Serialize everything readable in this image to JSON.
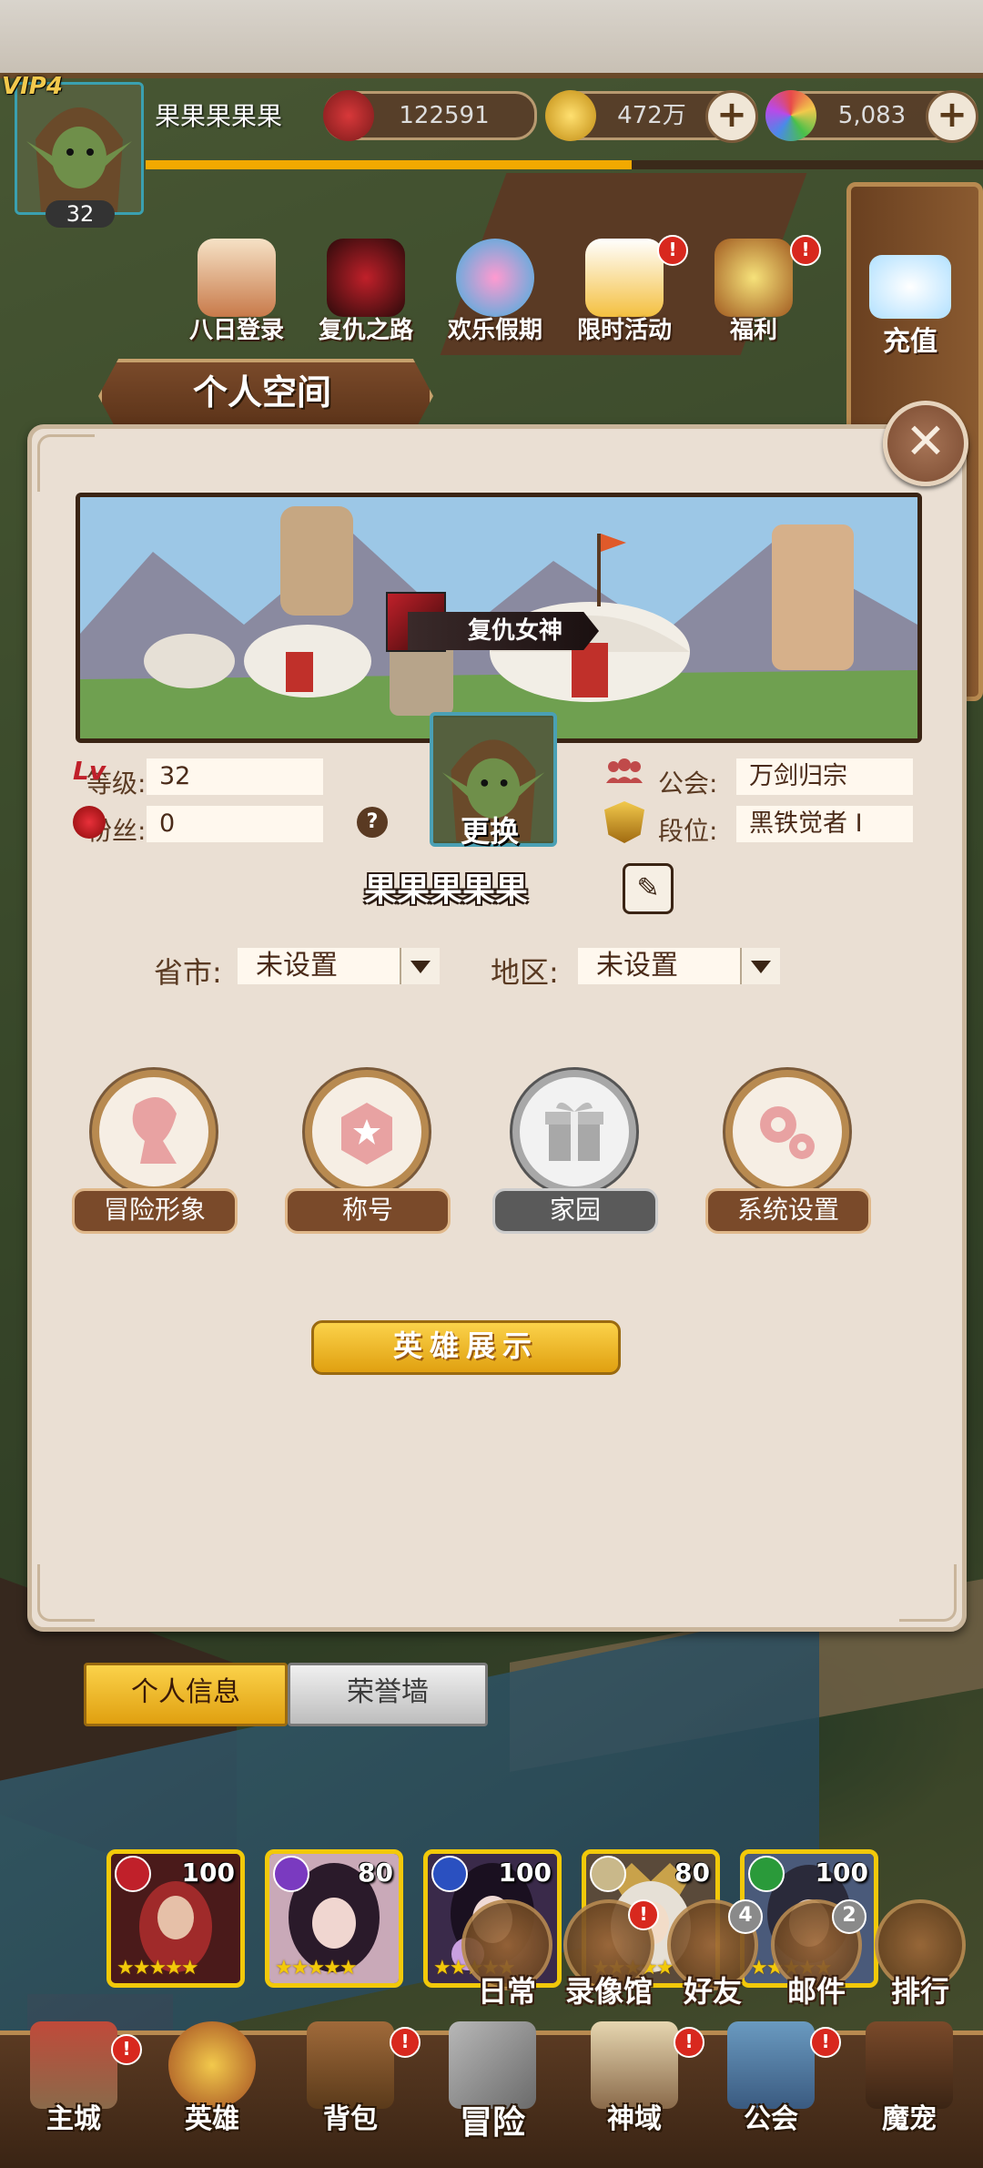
{
  "player": {
    "vip_label": "VIP",
    "vip_level": "4",
    "level": "32",
    "name": "果果果果果"
  },
  "resources": {
    "power": "122591",
    "gold": "472万",
    "gems": "5,083",
    "plus": "+"
  },
  "events": [
    {
      "label": "八日登录",
      "icon": "calendar-icon"
    },
    {
      "label": "复仇之路",
      "icon": "revenge-icon"
    },
    {
      "label": "欢乐假期",
      "icon": "holiday-icon"
    },
    {
      "label": "限时活动",
      "icon": "limited-event-icon",
      "badge": "!"
    },
    {
      "label": "福利",
      "icon": "gift-pot-icon",
      "badge": "!"
    }
  ],
  "topup_label": "充值",
  "panel": {
    "title": "个人空间",
    "close_symbol": "✕",
    "banner_name": "复仇女神",
    "change_label": "更换",
    "level_label": "等级:",
    "level_value": "32",
    "fans_label": "粉丝:",
    "fans_value": "0",
    "help_symbol": "?",
    "guild_label": "公会:",
    "guild_value": "万剑归宗",
    "rank_label": "段位:",
    "rank_value": "黑铁觉者 I",
    "nickname": "果果果果果",
    "province_label": "省市:",
    "province_value": "未设置",
    "region_label": "地区:",
    "region_value": "未设置",
    "functions": [
      {
        "label": "冒险形象",
        "icon": "adventure-image-icon",
        "enabled": true
      },
      {
        "label": "称号",
        "icon": "title-badge-icon",
        "enabled": true
      },
      {
        "label": "家园",
        "icon": "home-gift-icon",
        "enabled": false
      },
      {
        "label": "系统设置",
        "icon": "settings-gear-icon",
        "enabled": true
      }
    ],
    "showcase_label": "英雄展示",
    "heroes": [
      {
        "level": "100",
        "stars": "★★★★★",
        "element_color": "#c0202a"
      },
      {
        "level": "80",
        "stars": "★★★★★",
        "element_color": "#7a3ac0"
      },
      {
        "level": "100",
        "stars": "★★★★★",
        "element_color": "#2a50c0"
      },
      {
        "level": "80",
        "stars": "★★★★★",
        "element_color": "#c9b88a"
      },
      {
        "level": "100",
        "stars": "★★★★★",
        "element_color": "#2a9a3a"
      }
    ]
  },
  "bottom_tabs": {
    "info": "个人信息",
    "honor": "荣誉墙"
  },
  "quick_menu": [
    {
      "label": "日常"
    },
    {
      "label": "录像馆",
      "badge": "!"
    },
    {
      "label": "好友",
      "badge": "4"
    },
    {
      "label": "邮件",
      "badge": "2"
    },
    {
      "label": "排行"
    }
  ],
  "nav": [
    {
      "label": "主城",
      "badge": "!"
    },
    {
      "label": "英雄"
    },
    {
      "label": "背包",
      "badge": "!"
    },
    {
      "label": "冒险"
    },
    {
      "label": "神域",
      "badge": "!"
    },
    {
      "label": "公会",
      "badge": "!"
    },
    {
      "label": "魔宠"
    }
  ],
  "colors": {
    "panel_bg": "#eadfd3",
    "accent_gold": "#f2c90a",
    "brown": "#7a4a2a",
    "badge_red": "#d8281e"
  }
}
